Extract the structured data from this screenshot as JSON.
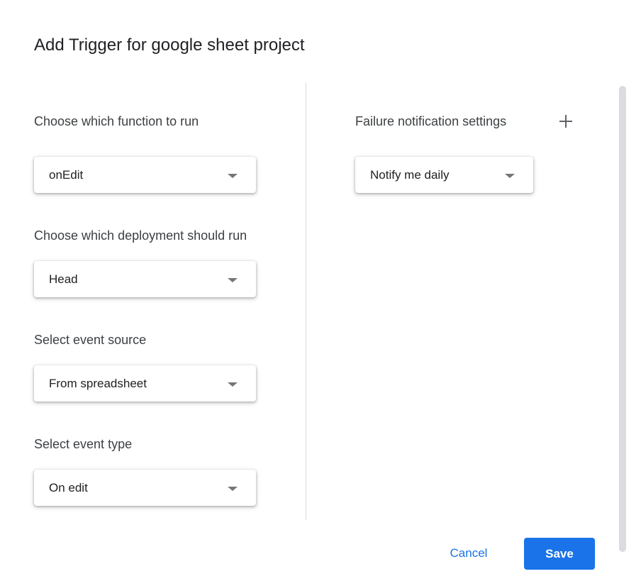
{
  "dialog": {
    "title": "Add Trigger for google sheet project"
  },
  "left": {
    "function_label": "Choose which function to run",
    "function_value": "onEdit",
    "deployment_label": "Choose which deployment should run",
    "deployment_value": "Head",
    "event_source_label": "Select event source",
    "event_source_value": "From spreadsheet",
    "event_type_label": "Select event type",
    "event_type_value": "On edit"
  },
  "right": {
    "failure_label": "Failure notification settings",
    "failure_value": "Notify me daily"
  },
  "actions": {
    "cancel_label": "Cancel",
    "save_label": "Save"
  },
  "colors": {
    "accent": "#1a73e8",
    "divider": "#dadce0",
    "caret": "#757575"
  },
  "icons": {
    "add": "plus-icon",
    "dropdown": "caret-down-icon"
  }
}
